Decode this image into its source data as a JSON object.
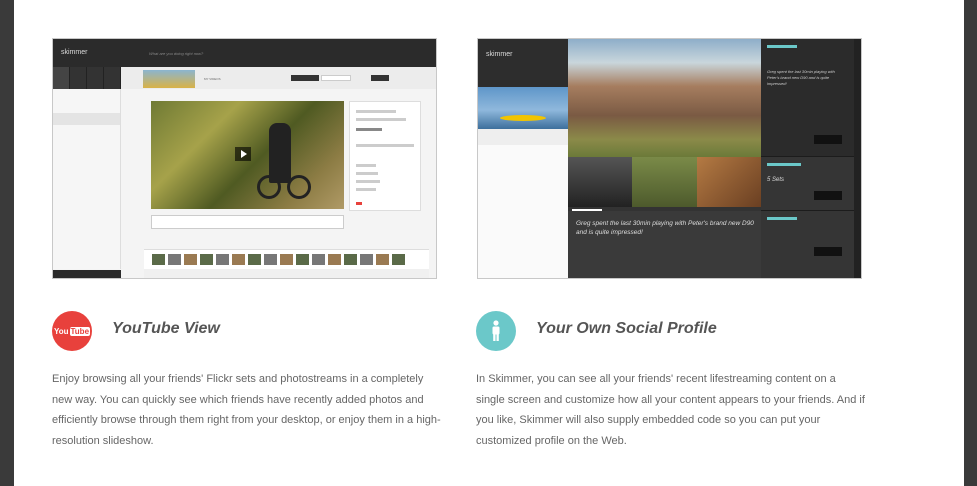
{
  "features": [
    {
      "icon": "youtube-icon",
      "logo_you": "You",
      "logo_tube": "Tube",
      "title": "YouTube View",
      "description": "Enjoy browsing all your friends' Flickr sets and photostreams in a completely new way. You can quickly see which friends have recently added photos and efficiently browse through them right from your desktop, or enjoy them in a high-resolution slideshow.",
      "accent": "#e8413c"
    },
    {
      "icon": "person-icon",
      "title": "Your Own Social Profile",
      "description": "In Skimmer, you can see all your friends' recent lifestreaming content on a single screen and customize how all your content appears to your friends. And if you like, Skimmer will also supply embedded code so you can put your customized profile on the Web.",
      "accent": "#6bc8c9"
    }
  ],
  "screens": {
    "youtube": {
      "logo": "skimmer",
      "status_prompt": "What are you doing right now?",
      "tab": "MY VIDEOS"
    },
    "profile": {
      "logo": "skimmer",
      "quote": "Greg spent the last 30min playing with Peter's brand new D90 and is quite impressed!",
      "side_status": "Greg spent the last 30min playing with Peter's brand new D90 and is quite impressed!",
      "sets": "5 Sets"
    }
  }
}
